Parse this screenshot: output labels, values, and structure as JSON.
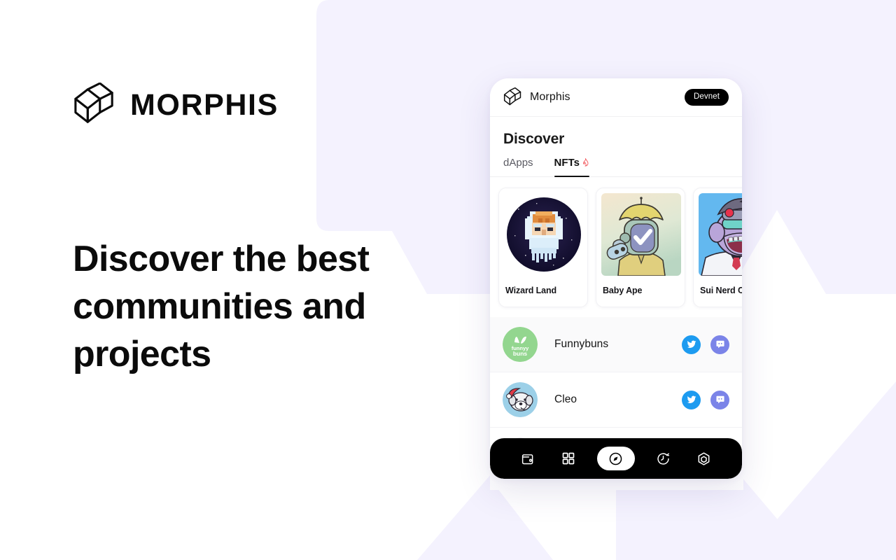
{
  "brand": {
    "wordmark": "MORPHIS",
    "logo_icon": "morphis-cube-icon"
  },
  "hero": {
    "headline": "Discover the best communities and projects"
  },
  "colors": {
    "background": "#ffffff",
    "decor_lavender": "#f4f2fe",
    "accent_black": "#000000",
    "twitter_blue": "#1d9bf0",
    "discord_purple": "#7b84e8",
    "fire_red": "#f2555a"
  },
  "phone": {
    "header": {
      "logo_icon": "morphis-cube-icon",
      "title": "Morphis",
      "network_badge": "Devnet"
    },
    "page_title": "Discover",
    "tabs": [
      {
        "label": "dApps",
        "active": false,
        "icon": ""
      },
      {
        "label": "NFTs",
        "active": true,
        "icon": "fire-icon",
        "icon_glyph": "🔥"
      }
    ],
    "nfts": [
      {
        "name": "Wizard Land",
        "art": "pixel-wizard-art"
      },
      {
        "name": "Baby Ape",
        "art": "baby-ape-astronaut-art"
      },
      {
        "name": "Sui Nerd Club",
        "art": "sui-nerd-ape-art"
      }
    ],
    "communities": [
      {
        "name": "Funnybuns",
        "avatar": "funnybuns-avatar",
        "avatar_text": "funnyy buns",
        "twitter": "twitter-icon",
        "discord": "discord-icon"
      },
      {
        "name": "Cleo",
        "avatar": "cleo-dog-avatar",
        "twitter": "twitter-icon",
        "discord": "discord-icon"
      },
      {
        "name": "",
        "avatar": "placeholder-avatar",
        "twitter": "twitter-icon",
        "discord": "discord-icon"
      }
    ],
    "bottom_nav": [
      {
        "icon": "wallet-icon",
        "active": false
      },
      {
        "icon": "apps-grid-icon",
        "active": false
      },
      {
        "icon": "compass-icon",
        "active": true
      },
      {
        "icon": "history-clock-icon",
        "active": false
      },
      {
        "icon": "settings-hexagon-icon",
        "active": false
      }
    ]
  }
}
